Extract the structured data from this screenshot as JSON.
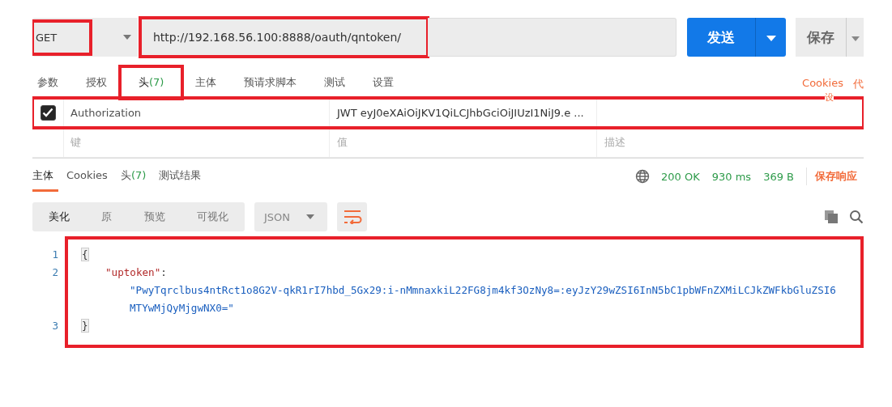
{
  "request": {
    "method": "GET",
    "url": "http://192.168.56.100:8888/oauth/qntoken/",
    "send_label": "发送",
    "save_label": "保存"
  },
  "request_tabs": [
    {
      "label": "参数",
      "selected": false
    },
    {
      "label": "授权",
      "selected": false
    },
    {
      "label": "头",
      "count": "(7)",
      "selected": true
    },
    {
      "label": "主体",
      "selected": false
    },
    {
      "label": "预请求脚本",
      "selected": false
    },
    {
      "label": "测试",
      "selected": false
    },
    {
      "label": "设置",
      "selected": false
    }
  ],
  "request_links": [
    "Cookies",
    "代"
  ],
  "request_links_overflow": "设",
  "headers": {
    "rows": [
      {
        "checked": true,
        "key": "Authorization",
        "value": "JWT eyJ0eXAiOiJKV1QiLCJhbGciOiJIUzI1NiJ9.e ..."
      }
    ],
    "placeholders": {
      "key": "键",
      "value": "值",
      "description": "描述"
    }
  },
  "response_tabs": [
    {
      "label": "主体",
      "selected": true
    },
    {
      "label": "Cookies",
      "selected": false
    },
    {
      "label": "头",
      "count": "(7)",
      "selected": false
    },
    {
      "label": "测试结果",
      "selected": false
    }
  ],
  "status": {
    "code": "200 OK",
    "time": "930 ms",
    "size": "369 B",
    "save_response": "保存响应"
  },
  "view_modes": [
    {
      "label": "美化",
      "selected": true
    },
    {
      "label": "原",
      "selected": false
    },
    {
      "label": "预览",
      "selected": false
    },
    {
      "label": "可视化",
      "selected": false
    }
  ],
  "format": "JSON",
  "code_lines": [
    {
      "number": "1",
      "kind": "brace",
      "text": "{"
    },
    {
      "number": "2",
      "kind": "key",
      "text": "\"uptoken\"",
      "suffix": ":",
      "continuation": [
        "\"PwyTqrclbus4ntRct1o8G2V-qkR1rI7hbd_5Gx29:i-nMmnaxkiL22FG8jm4kf3OzNy8=:eyJzY29wZSI6InN5bC1pbWFnZXMiLCJkZWFkbGluZSI6",
        "MTYwMjQyMjgwNX0=\""
      ]
    },
    {
      "number": "3",
      "kind": "brace",
      "text": "}"
    }
  ],
  "highlights": {
    "method": true,
    "url": true,
    "headers_tab": true,
    "header_row": true,
    "response_body": true
  }
}
